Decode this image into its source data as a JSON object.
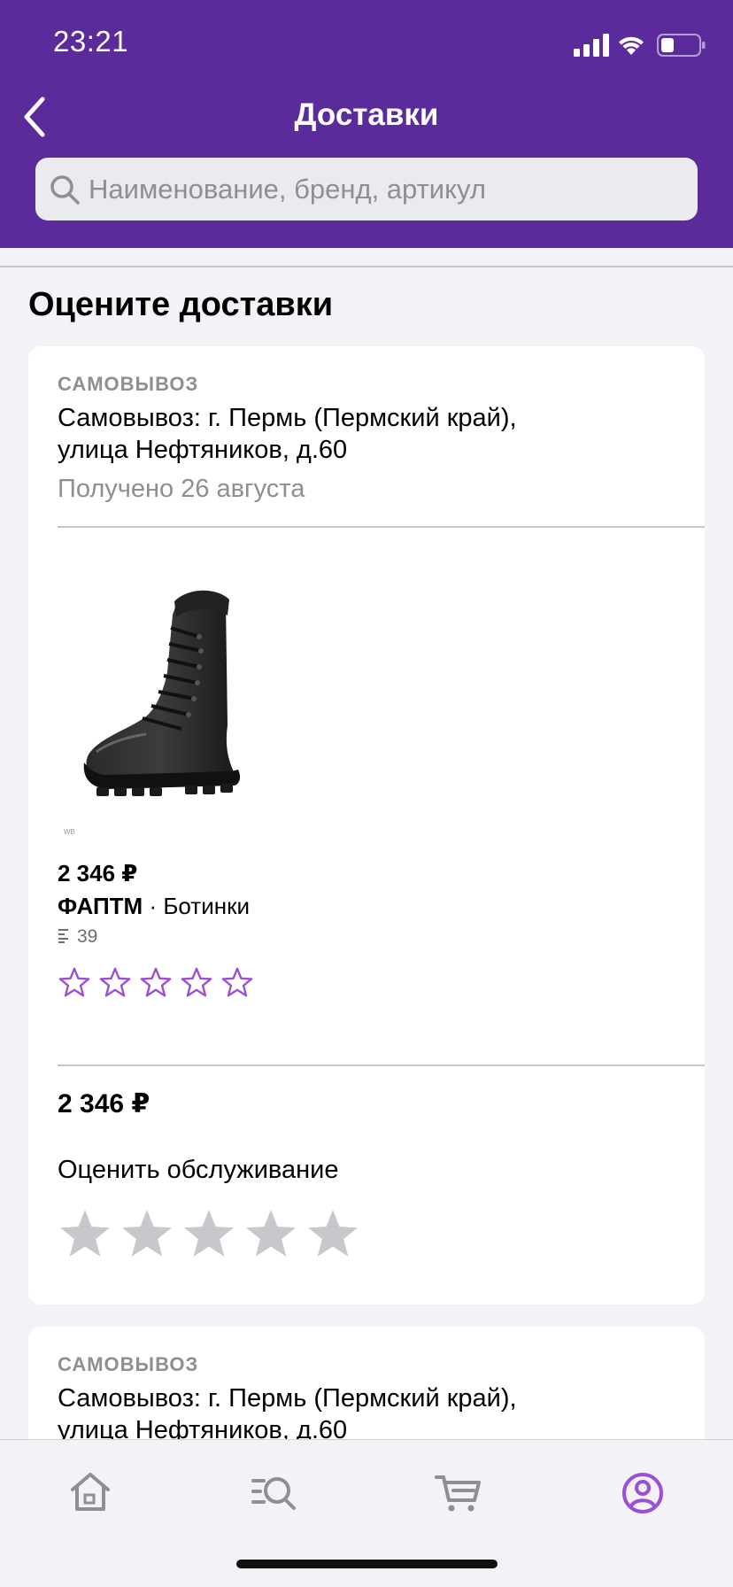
{
  "status_bar": {
    "time": "23:21"
  },
  "nav": {
    "title": "Доставки"
  },
  "search": {
    "placeholder": "Наименование, бренд, артикул"
  },
  "section": {
    "title": "Оцените доставки"
  },
  "deliveries": [
    {
      "label": "САМОВЫВОЗ",
      "address_line1": "Самовывоз: г. Пермь (Пермский край),",
      "address_line2": "улица Нефтяников, д.60",
      "status": "Получено 26 августа",
      "product": {
        "price": "2 346 ₽",
        "brand": "ФАПТМ",
        "separator": " · ",
        "name": "Ботинки",
        "size": "39",
        "image_mark": "WB",
        "rating": 0,
        "rating_max": 5
      },
      "total": "2 346 ₽",
      "service_label": "Оценить обслуживание",
      "service_rating": 0
    },
    {
      "label": "САМОВЫВОЗ",
      "address_line1": "Самовывоз: г. Пермь (Пермский край),",
      "address_line2": "улица Нефтяников, д.60"
    }
  ],
  "tabs": [
    {
      "icon": "home-icon"
    },
    {
      "icon": "catalog-search-icon"
    },
    {
      "icon": "cart-icon"
    },
    {
      "icon": "profile-icon"
    }
  ],
  "colors": {
    "header": "#5b2a9b",
    "accent_purple": "#9b4fd6",
    "star_gray": "#c7c7cc",
    "secondary_text": "#8e8e93"
  }
}
